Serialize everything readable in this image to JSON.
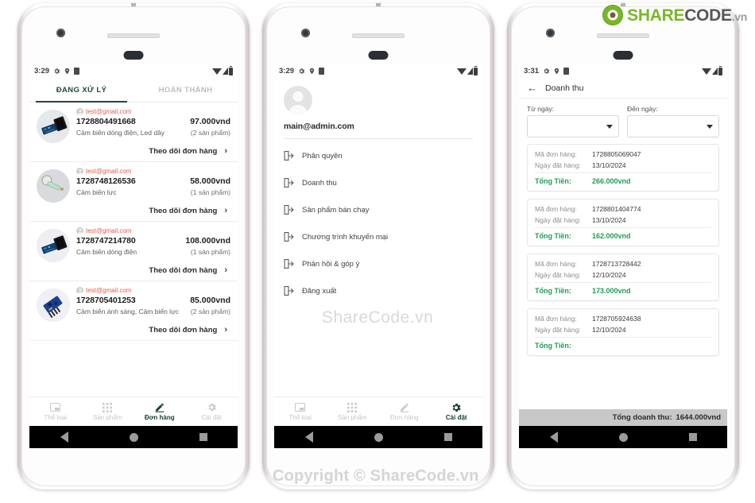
{
  "branding": {
    "logo_share": "SHARE",
    "logo_code": "CODE",
    "logo_vn": ".vn",
    "watermark_center": "ShareCode.vn",
    "watermark_bottom": "Copyright © ShareCode.vn"
  },
  "phone1": {
    "status_bar": {
      "time": "3:29",
      "icons": [
        "gear-icon",
        "location-icon",
        "sim-icon",
        "wifi-icon",
        "signal-icon",
        "battery-icon"
      ]
    },
    "tabs": [
      {
        "label": "ĐANG XỬ LÝ",
        "active": true
      },
      {
        "label": "HOÀN THÀNH",
        "active": false
      }
    ],
    "orders": [
      {
        "email": "test@gmail.com",
        "id": "1728804491668",
        "price": "97.000vnd",
        "desc": "Cảm biến dòng điện, Led dây",
        "qty": "(2 sản phẩm)",
        "track": "Theo dõi đơn hàng"
      },
      {
        "email": "test@gmail.com",
        "id": "1728748126536",
        "price": "58.000vnd",
        "desc": "Cảm biến lực",
        "qty": "(1 sản phẩm)",
        "track": "Theo dõi đơn hàng"
      },
      {
        "email": "test@gmail.com",
        "id": "1728747214780",
        "price": "108.000vnd",
        "desc": "Cảm biến dòng điện",
        "qty": "(1 sản phẩm)",
        "track": "Theo dõi đơn hàng"
      },
      {
        "email": "test@gmail.com",
        "id": "1728705401253",
        "price": "85.000vnd",
        "desc": "Cảm biến ánh sáng, Cảm biến lực",
        "qty": "(2 sản phẩm)",
        "track": "Theo dõi đơn hàng"
      }
    ],
    "bottom_nav": [
      {
        "label": "Thể loại",
        "icon": "category-icon",
        "active": false
      },
      {
        "label": "Sản phẩm",
        "icon": "grid-icon",
        "active": false
      },
      {
        "label": "Đơn hàng",
        "icon": "pencil-icon",
        "active": true
      },
      {
        "label": "Cài đặt",
        "icon": "gear-icon",
        "active": false
      }
    ]
  },
  "phone2": {
    "status_bar": {
      "time": "3:29"
    },
    "account_email": "main@admin.com",
    "menu": [
      {
        "label": "Phân quyền",
        "icon": "exit-arrow-icon"
      },
      {
        "label": "Doanh thu",
        "icon": "exit-arrow-icon"
      },
      {
        "label": "Sản phẩm bán chạy",
        "icon": "exit-arrow-icon"
      },
      {
        "label": "Chương trình khuyến mại",
        "icon": "exit-arrow-icon"
      },
      {
        "label": "Phản hồi & góp ý",
        "icon": "exit-arrow-icon"
      },
      {
        "label": "Đăng xuất",
        "icon": "exit-arrow-icon"
      }
    ],
    "bottom_nav": [
      {
        "label": "Thể loại",
        "icon": "category-icon",
        "active": false
      },
      {
        "label": "Sản phẩm",
        "icon": "grid-icon",
        "active": false
      },
      {
        "label": "Đơn hàng",
        "icon": "pencil-icon",
        "active": false
      },
      {
        "label": "Cài đặt",
        "icon": "gear-icon",
        "active": true
      }
    ]
  },
  "phone3": {
    "status_bar": {
      "time": "3:31"
    },
    "appbar": {
      "back": "←",
      "title": "Doanh thu"
    },
    "filters": [
      {
        "label": "Từ ngày:",
        "value": ""
      },
      {
        "label": "Đến ngày:",
        "value": ""
      }
    ],
    "field_labels": {
      "order_id": "Mã đơn hàng:",
      "order_date": "Ngày đặt hàng:",
      "total": "Tổng Tiền:"
    },
    "revenue_items": [
      {
        "id": "1728805069047",
        "date": "13/10/2024",
        "total": "266.000vnd"
      },
      {
        "id": "1728801404774",
        "date": "13/10/2024",
        "total": "162.000vnd"
      },
      {
        "id": "1728713728442",
        "date": "12/10/2024",
        "total": "173.000vnd"
      },
      {
        "id": "1728705924638",
        "date": "12/10/2024",
        "total": ""
      }
    ],
    "footer": {
      "label": "Tổng doanh thu:",
      "value": "1644.000vnd"
    }
  },
  "colors": {
    "accent_green": "#1f4a39",
    "total_green": "#1f9d55",
    "email_red": "#e45b4a",
    "brand_green": "#7ab728"
  }
}
